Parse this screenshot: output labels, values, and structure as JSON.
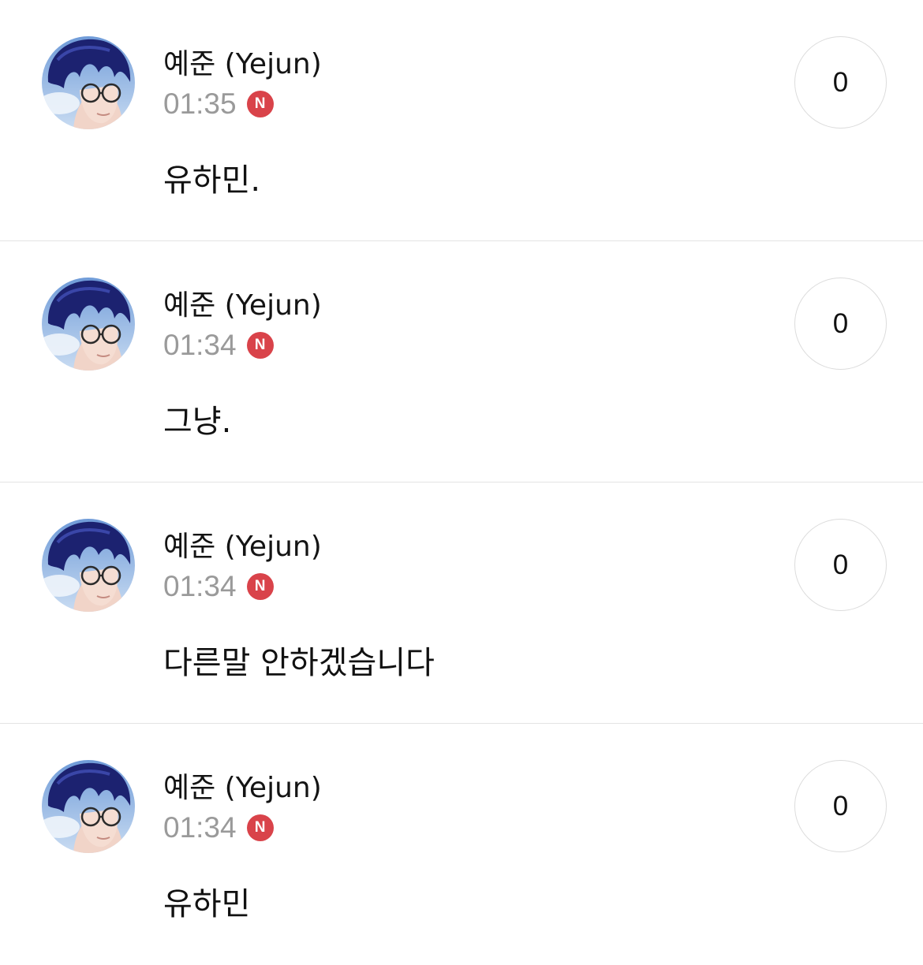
{
  "theme": {
    "badge_color": "#d9434a",
    "divider_color": "#e3e3e3",
    "time_color": "#9a9a9a"
  },
  "posts": [
    {
      "author": "예준 (Yejun)",
      "time": "01:35",
      "badge": "N",
      "message": "유하민.",
      "count": "0"
    },
    {
      "author": "예준 (Yejun)",
      "time": "01:34",
      "badge": "N",
      "message": "그냥.",
      "count": "0"
    },
    {
      "author": "예준 (Yejun)",
      "time": "01:34",
      "badge": "N",
      "message": "다른말 안하겠습니다",
      "count": "0"
    },
    {
      "author": "예준 (Yejun)",
      "time": "01:34",
      "badge": "N",
      "message": "유하민",
      "count": "0"
    }
  ]
}
